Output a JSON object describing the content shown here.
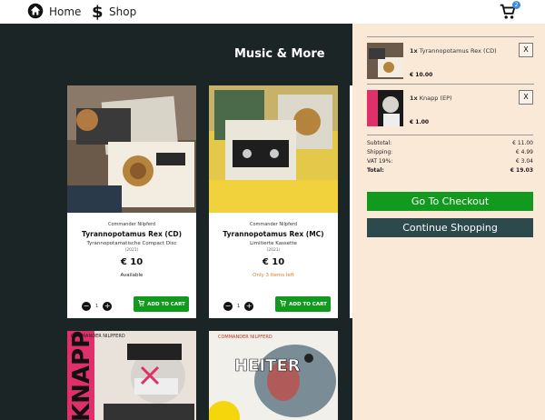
{
  "nav": {
    "home_label": "Home",
    "shop_label": "Shop",
    "cart_count": "2"
  },
  "section_title": "Music & More",
  "products": [
    {
      "artist": "Commander Nilpferd",
      "name": "Tyrannopotamus Rex (CD)",
      "desc": "Tyrannopotamatische Compact Disc",
      "year": "(2021)",
      "price": "€ 10",
      "stock": "Available",
      "stock_color": "#222222",
      "qty": "1",
      "add_label": "ADD TO CART"
    },
    {
      "artist": "Commander Nilpferd",
      "name": "Tyrannopotamus Rex (MC)",
      "desc": "Limitierte Kassette",
      "year": "(2021)",
      "price": "€ 10",
      "stock": "Only 3 Items left",
      "stock_color": "#e07a1f",
      "qty": "1",
      "add_label": "ADD TO CART"
    },
    {
      "cover_text": "COMMANDER NILPFERD",
      "title_text": "KNAPP"
    },
    {
      "cover_text": "COMMANDER NILPFERD",
      "title_text": "HEITER"
    }
  ],
  "cart": {
    "items": [
      {
        "qty": "1x",
        "name": "Tyrannopotamus Rex (CD)",
        "price": "€ 10.00",
        "remove": "X"
      },
      {
        "qty": "1x",
        "name": "Knapp (EP)",
        "price": "€ 1.00",
        "remove": "X"
      }
    ],
    "totals": {
      "subtotal_label": "Subtotal:",
      "subtotal": "€ 11.00",
      "shipping_label": "Shipping:",
      "shipping": "€ 4.99",
      "vat_label": "VAT 19%:",
      "vat": "€ 3.04",
      "total_label": "Total:",
      "total": "€ 19.03"
    },
    "checkout_label": "Go To Checkout",
    "continue_label": "Continue Shopping"
  },
  "colors": {
    "accent_green": "#129a1e",
    "dark_teal": "#2c4a4c",
    "panel_bg": "#fbe9d8",
    "page_bg": "#1c2526"
  }
}
